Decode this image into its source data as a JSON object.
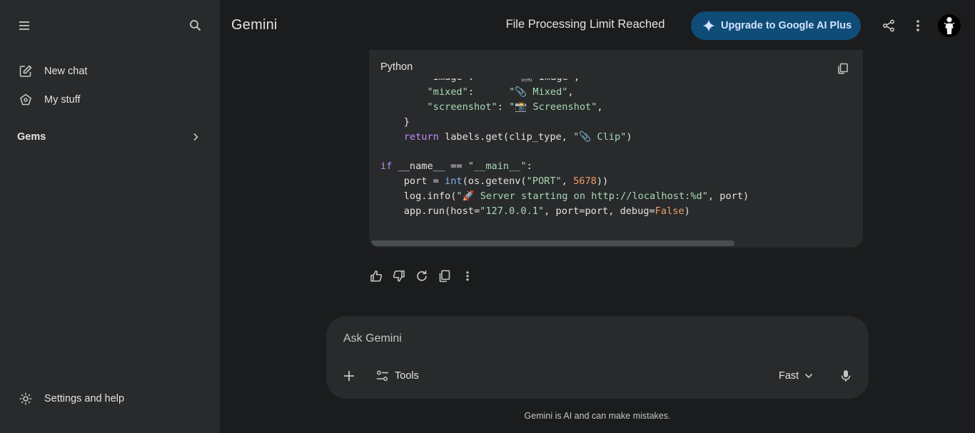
{
  "sidebar": {
    "menu_icon": "menu-icon",
    "search_icon": "search-icon",
    "new_chat_label": "New chat",
    "my_stuff_label": "My stuff",
    "gems_label": "Gems",
    "settings_label": "Settings and help"
  },
  "header": {
    "brand": "Gemini",
    "chat_title": "File Processing Limit Reached",
    "upgrade_label": "Upgrade to Google AI Plus"
  },
  "code_block": {
    "language": "Python",
    "lines": [
      [
        {
          "t": "        \"image\":       \"🖼 Image\","
        }
      ],
      [
        {
          "t": "        "
        },
        {
          "c": "s",
          "t": "\"mixed\""
        },
        {
          "t": ":      "
        },
        {
          "c": "s",
          "t": "\"📎 Mixed\""
        },
        {
          "t": ","
        }
      ],
      [
        {
          "t": "        "
        },
        {
          "c": "s",
          "t": "\"screenshot\""
        },
        {
          "t": ": "
        },
        {
          "c": "s",
          "t": "\"📸 Screenshot\""
        },
        {
          "t": ","
        }
      ],
      [
        {
          "t": "    }"
        }
      ],
      [
        {
          "t": "    "
        },
        {
          "c": "k",
          "t": "return"
        },
        {
          "t": " labels.get(clip_type, "
        },
        {
          "c": "s",
          "t": "\"📎 Clip\""
        },
        {
          "t": ")"
        }
      ],
      [
        {
          "t": ""
        }
      ],
      [
        {
          "c": "k",
          "t": "if"
        },
        {
          "t": " __name__ == "
        },
        {
          "c": "s",
          "t": "\"__main__\""
        },
        {
          "t": ":"
        }
      ],
      [
        {
          "t": "    port = "
        },
        {
          "c": "b",
          "t": "int"
        },
        {
          "t": "(os.getenv("
        },
        {
          "c": "s",
          "t": "\"PORT\""
        },
        {
          "t": ", "
        },
        {
          "c": "n",
          "t": "5678"
        },
        {
          "t": "))"
        }
      ],
      [
        {
          "t": "    log.info("
        },
        {
          "c": "s",
          "t": "\"🚀 Server starting on http://localhost:%d\""
        },
        {
          "t": ", port)"
        }
      ],
      [
        {
          "t": "    app.run(host="
        },
        {
          "c": "s",
          "t": "\"127.0.0.1\""
        },
        {
          "t": ", port=port, debug="
        },
        {
          "c": "n",
          "t": "False"
        },
        {
          "t": ")"
        }
      ]
    ]
  },
  "feedback": {
    "thumbs_up": "thumbs-up-icon",
    "thumbs_down": "thumbs-down-icon",
    "regenerate": "refresh-icon",
    "copy": "copy-icon",
    "more": "more-vert-icon"
  },
  "composer": {
    "placeholder": "Ask Gemini",
    "tools_label": "Tools",
    "mode_label": "Fast"
  },
  "disclaimer": "Gemini is AI and can make mistakes.",
  "colors": {
    "background": "#1b1c1d",
    "sidebar": "#282a2c",
    "upgrade_button": "#0f4c78",
    "keyword": "#c58af9",
    "string": "#a8dab5",
    "builtin": "#8ab4f8",
    "number": "#f29c6b"
  }
}
